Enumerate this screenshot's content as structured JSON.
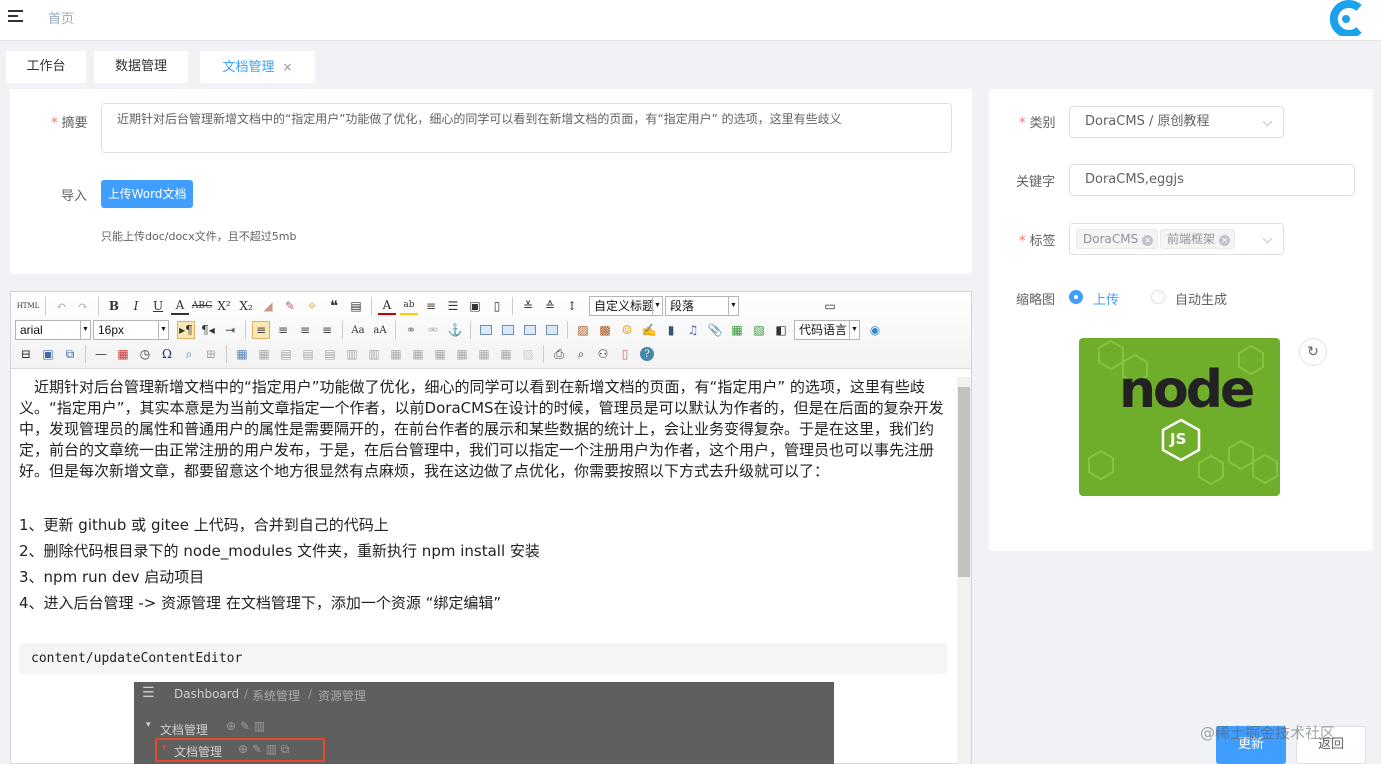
{
  "header": {
    "breadcrumb": "首页"
  },
  "tabs": [
    {
      "label": "工作台"
    },
    {
      "label": "数据管理"
    },
    {
      "label": "文档管理",
      "close": "×"
    }
  ],
  "form": {
    "summary_label": "摘要",
    "summary_value": "近期针对后台管理新增文档中的“指定用户”功能做了优化，细心的同学可以看到在新增文档的页面，有“指定用户” 的选项，这里有些歧义",
    "import_label": "导入",
    "upload_button": "上传Word文档",
    "upload_tip": "只能上传doc/docx文件，且不超过5mb"
  },
  "editor": {
    "font_family": "arial",
    "font_size": "16px",
    "custom_title": "自定义标题",
    "paragraph": "段落",
    "code_lang": "代码语言",
    "paragraph_text": "近期针对后台管理新增文档中的“指定用户”功能做了优化，细心的同学可以看到在新增文档的页面，有“指定用户” 的选项，这里有些歧义。“指定用户”，其实本意是为当前文章指定一个作者，以前DoraCMS在设计的时候，管理员是可以默认为作者的，但是在后面的复杂开发中，发现管理员的属性和普通用户的属性是需要隔开的，在前台作者的展示和某些数据的统计上，会让业务变得复杂。于是在这里，我们约定，前台的文章统一由正常注册的用户发布，于是，在后台管理中，我们可以指定一个注册用户为作者，这个用户，管理员也可以事先注册好。但是每次新增文章，都要留意这个地方很显然有点麻烦，我在这边做了点优化，你需要按照以下方式去升级就可以了：",
    "steps": [
      "1、更新 github 或 gitee 上代码，合并到自己的代码上",
      "2、删除代码根目录下的 node_modules 文件夹，重新执行 npm install 安装",
      "3、npm run dev 启动项目",
      "4、进入后台管理 -> 资源管理  在文档管理下，添加一个资源 “绑定编辑”"
    ],
    "code": "content/updateContentEditor",
    "shot": {
      "crumb1": "Dashboard",
      "crumb_sep": "/",
      "crumb2": "系统管理",
      "crumb3": "资源管理",
      "tree1": "文档管理",
      "tree2": "文档管理"
    }
  },
  "side": {
    "category_label": "类别",
    "category_value": "DoraCMS / 原创教程",
    "keywords_label": "关键字",
    "keywords_value": "DoraCMS,eggjs",
    "tags_label": "标签",
    "tags": [
      "DoraCMS",
      "前端框架"
    ],
    "thumb_label": "缩略图",
    "radio_upload": "上传",
    "radio_auto": "自动生成",
    "thumb_text": "node",
    "thumb_badge": "JS",
    "refresh_icon": "↻"
  },
  "footer": {
    "update": "更新",
    "back": "返回",
    "watermark": "@稀土掘金技术社区"
  },
  "colors": {
    "primary": "#409eff",
    "danger": "#f56c6c",
    "node_green": "#6fae2b"
  }
}
